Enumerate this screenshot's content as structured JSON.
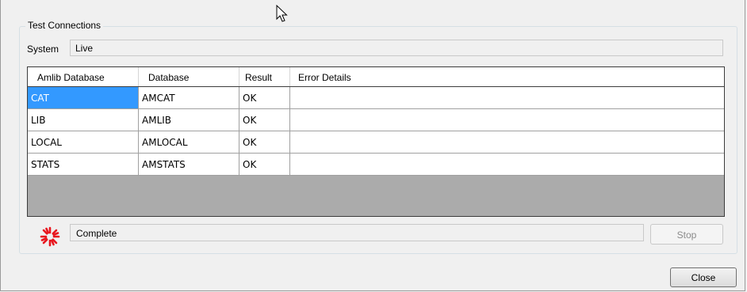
{
  "group": {
    "title": "Test Connections"
  },
  "system": {
    "label": "System",
    "value": "Live"
  },
  "grid": {
    "columns": [
      "Amlib Database",
      "Database",
      "Result",
      "Error Details"
    ],
    "rows": [
      {
        "amlib": "CAT",
        "database": "AMCAT",
        "result": "OK",
        "error": ""
      },
      {
        "amlib": "LIB",
        "database": "AMLIB",
        "result": "OK",
        "error": ""
      },
      {
        "amlib": "LOCAL",
        "database": "AMLOCAL",
        "result": "OK",
        "error": ""
      },
      {
        "amlib": "STATS",
        "database": "AMSTATS",
        "result": "OK",
        "error": ""
      }
    ],
    "selected_row": 0
  },
  "status": {
    "text": "Complete",
    "icon": "spinner-icon",
    "icon_color": "#e8161e"
  },
  "buttons": {
    "stop": "Stop",
    "close": "Close"
  },
  "colors": {
    "selection": "#3399ff",
    "empty_grid": "#ababab"
  }
}
